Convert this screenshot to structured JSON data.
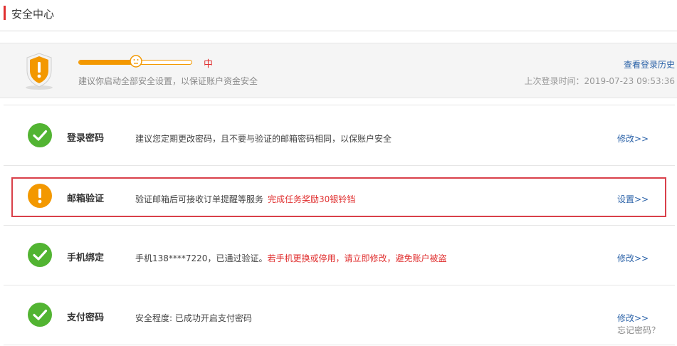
{
  "header": {
    "title": "安全中心"
  },
  "summary": {
    "level_label": "中",
    "level_percent": 50,
    "suggestion": "建议你启动全部安全设置，以保证账户资金安全",
    "history_link": "查看登录历史",
    "last_login": "上次登录时间：2019-07-23 09:53:36"
  },
  "items": [
    {
      "name": "登录密码",
      "status": "ok",
      "desc": "建议您定期更改密码，且不要与验证的邮箱密码相同，以保账户安全",
      "warn": "",
      "action": "修改>>",
      "sub_action": ""
    },
    {
      "name": "邮箱验证",
      "status": "warning",
      "desc": "验证邮箱后可接收订单提醒等服务",
      "warn": "完成任务奖励30银铃铛",
      "action": "设置>>",
      "sub_action": ""
    },
    {
      "name": "手机绑定",
      "status": "ok",
      "desc": "手机138****7220，已通过验证。",
      "warn": "若手机更换或停用，请立即修改，避免账户被盗",
      "action": "修改>>",
      "sub_action": ""
    },
    {
      "name": "支付密码",
      "status": "ok",
      "desc": "安全程度: 已成功开启支付密码",
      "warn": "",
      "action": "修改>>",
      "sub_action": "忘记密码？"
    }
  ],
  "colors": {
    "accent_red": "#e02f2f",
    "ok_green": "#52b432",
    "warn_orange": "#f39800",
    "link_blue": "#2b62a8"
  }
}
